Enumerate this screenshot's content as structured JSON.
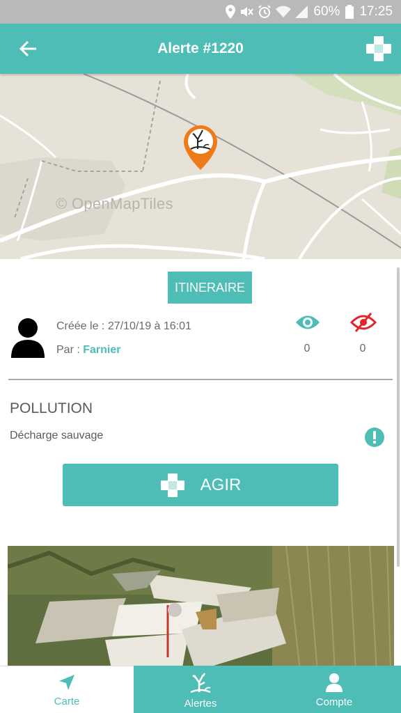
{
  "status_bar": {
    "battery": "60%",
    "time": "17:25",
    "icons": [
      "location-icon",
      "mute-icon",
      "alarm-icon",
      "wifi-icon",
      "signal-icon",
      "battery-icon"
    ]
  },
  "app_bar": {
    "title": "Alerte #1220",
    "back_icon": "arrow-back-icon",
    "action_icon": "cross-plus-icon"
  },
  "map": {
    "credit": "© OpenMapTiles",
    "marker_icon": "pollution-tree-marker-icon"
  },
  "alert": {
    "route_button": "ITINERAIRE",
    "created_label": "Créée le : 27/10/19 à 16:01",
    "author_prefix": "Par : ",
    "author_name": "Farnier",
    "seen_count": "0",
    "unseen_count": "0",
    "category": "POLLUTION",
    "subcategory": "Décharge sauvage",
    "act_button": "AGIR"
  },
  "bottom_nav": {
    "items": [
      {
        "label": "Carte",
        "icon": "navigation-arrow-icon",
        "active": true
      },
      {
        "label": "Alertes",
        "icon": "tree-icon",
        "active": false
      },
      {
        "label": "Compte",
        "icon": "user-icon",
        "active": false
      }
    ]
  },
  "colors": {
    "accent": "#4dbdb5",
    "status_bar": "#b9b9b9",
    "map_bg": "#e6e2d7",
    "marker": "#ef7a1a",
    "alert_red": "#e0262c"
  }
}
